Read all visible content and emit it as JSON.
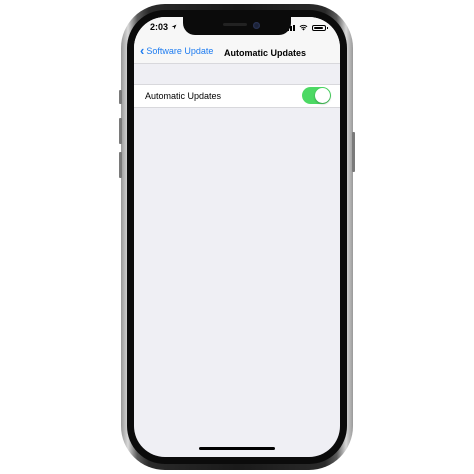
{
  "status_bar": {
    "time": "2:03",
    "location_icon": "location-arrow-icon",
    "signal_icon": "cellular-signal-icon",
    "wifi_icon": "wifi-icon",
    "battery_icon": "battery-icon"
  },
  "nav": {
    "back_label": "Software Update",
    "back_icon": "chevron-left-icon",
    "title": "Automatic Updates"
  },
  "settings": {
    "rows": [
      {
        "label": "Automatic Updates",
        "toggle_on": true
      }
    ]
  },
  "colors": {
    "accent": "#1e7cf0",
    "toggle_on": "#4cd964",
    "background": "#efeff4"
  }
}
